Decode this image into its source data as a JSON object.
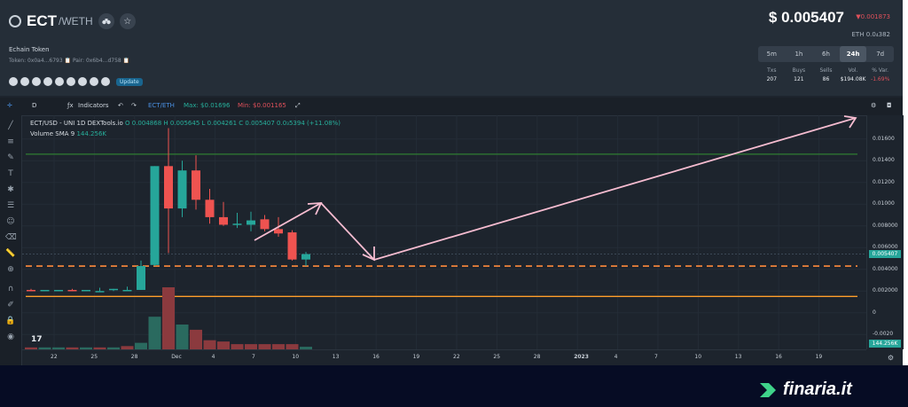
{
  "header": {
    "symbol": "ECT",
    "quote": "/WETH",
    "token_name": "Echain Token",
    "token_meta": "Token: 0x0a4...6793  📋  Pair: 0x6b4...d758  📋",
    "update_label": "Update",
    "price": "$ 0.005407",
    "price_change": "▼0.001873",
    "eth_price": "ETH  0.0₄382",
    "timeframes": [
      "5m",
      "1h",
      "6h",
      "24h",
      "7d"
    ],
    "active_timeframe": "24h",
    "stats": [
      {
        "label": "Txs",
        "value": "207"
      },
      {
        "label": "Buys",
        "value": "121"
      },
      {
        "label": "Sells",
        "value": "86"
      },
      {
        "label": "Vol.",
        "value": "$194.08K"
      },
      {
        "label": "% Var.",
        "value": "-1.69%"
      }
    ]
  },
  "toolbar": {
    "interval": "D",
    "indicators_label": "Indicators",
    "pair_label": "ECT/ETH",
    "max_label": "Max: $0.01696",
    "min_label": "Min: $0.001165"
  },
  "legend": {
    "title": "ECT/USD - UNI  1D  DEXTools.io",
    "o": "O 0.004868",
    "h": "H 0.005645",
    "l": "L 0.004261",
    "c": "C 0.005407",
    "chg": "0.0₃5394 (+11.08%)",
    "volume_label": "Volume SMA 9",
    "volume_value": "144.256K"
  },
  "chart_data": {
    "type": "candlestick",
    "x_tick_labels": [
      "22",
      "25",
      "28",
      "Dec",
      "4",
      "7",
      "10",
      "13",
      "16",
      "19",
      "22",
      "25",
      "28",
      "2023",
      "4",
      "7",
      "10",
      "13",
      "16",
      "19"
    ],
    "y_tick_labels": [
      "0.01600",
      "0.01400",
      "0.01200",
      "0.01000",
      "0.008000",
      "0.006000",
      "0.004000",
      "0.002000",
      "0",
      "-0.0020"
    ],
    "ylim": [
      -0.0028,
      0.0172
    ],
    "last_price_badge": "0.005407",
    "volume_badge": "144.256K",
    "candles": [
      {
        "o": 0.0021,
        "h": 0.0022,
        "l": 0.002,
        "c": 0.002
      },
      {
        "o": 0.002,
        "h": 0.0021,
        "l": 0.002,
        "c": 0.0021
      },
      {
        "o": 0.002,
        "h": 0.0021,
        "l": 0.002,
        "c": 0.0021
      },
      {
        "o": 0.0021,
        "h": 0.0022,
        "l": 0.002,
        "c": 0.002
      },
      {
        "o": 0.002,
        "h": 0.0021,
        "l": 0.002,
        "c": 0.0021
      },
      {
        "o": 0.002,
        "h": 0.0023,
        "l": 0.002,
        "c": 0.002
      },
      {
        "o": 0.0021,
        "h": 0.0022,
        "l": 0.002,
        "c": 0.0022
      },
      {
        "o": 0.0021,
        "h": 0.0024,
        "l": 0.0021,
        "c": 0.0021
      },
      {
        "o": 0.0021,
        "h": 0.0048,
        "l": 0.0021,
        "c": 0.0043
      },
      {
        "o": 0.0044,
        "h": 0.0135,
        "l": 0.0043,
        "c": 0.0135
      },
      {
        "o": 0.0135,
        "h": 0.017,
        "l": 0.0055,
        "c": 0.0096
      },
      {
        "o": 0.0096,
        "h": 0.014,
        "l": 0.0088,
        "c": 0.0131
      },
      {
        "o": 0.0131,
        "h": 0.0145,
        "l": 0.0095,
        "c": 0.0104
      },
      {
        "o": 0.0104,
        "h": 0.0114,
        "l": 0.0082,
        "c": 0.0088
      },
      {
        "o": 0.0088,
        "h": 0.0102,
        "l": 0.008,
        "c": 0.0081
      },
      {
        "o": 0.0081,
        "h": 0.0092,
        "l": 0.0078,
        "c": 0.0082
      },
      {
        "o": 0.0081,
        "h": 0.0093,
        "l": 0.0075,
        "c": 0.0085
      },
      {
        "o": 0.0086,
        "h": 0.009,
        "l": 0.0075,
        "c": 0.0077
      },
      {
        "o": 0.0077,
        "h": 0.0088,
        "l": 0.007,
        "c": 0.0073
      },
      {
        "o": 0.0074,
        "h": 0.0076,
        "l": 0.0048,
        "c": 0.0049
      },
      {
        "o": 0.0049,
        "h": 0.0056,
        "l": 0.0043,
        "c": 0.0054
      }
    ],
    "volume": [
      {
        "v": 3,
        "up": false
      },
      {
        "v": 3,
        "up": true
      },
      {
        "v": 3,
        "up": true
      },
      {
        "v": 3,
        "up": false
      },
      {
        "v": 3,
        "up": true
      },
      {
        "v": 3,
        "up": false
      },
      {
        "v": 3,
        "up": true
      },
      {
        "v": 5,
        "up": false
      },
      {
        "v": 10,
        "up": true
      },
      {
        "v": 50,
        "up": true
      },
      {
        "v": 95,
        "up": false
      },
      {
        "v": 38,
        "up": true
      },
      {
        "v": 30,
        "up": false
      },
      {
        "v": 14,
        "up": false
      },
      {
        "v": 12,
        "up": false
      },
      {
        "v": 8,
        "up": false
      },
      {
        "v": 8,
        "up": false
      },
      {
        "v": 8,
        "up": false
      },
      {
        "v": 8,
        "up": false
      },
      {
        "v": 8,
        "up": false
      },
      {
        "v": 4,
        "up": true
      }
    ],
    "levels": {
      "resistance": 0.0146,
      "support_dashed": 0.0043,
      "support_orange": 0.0015
    },
    "colors": {
      "up": "#26a69a",
      "down": "#ef5350",
      "vol_up": "#2a6a5f",
      "vol_down": "#8b3a3e",
      "resistance": "#2e7d32",
      "dashed": "#ff8a3d",
      "support": "#ff9e2a",
      "arrow": "#f6bcd0"
    }
  },
  "brand": {
    "text": "finaria.it"
  },
  "icons": [
    "binoculars-icon",
    "star-icon",
    "crosshair-icon",
    "settings-icon",
    "camera-icon",
    "gear-icon"
  ]
}
